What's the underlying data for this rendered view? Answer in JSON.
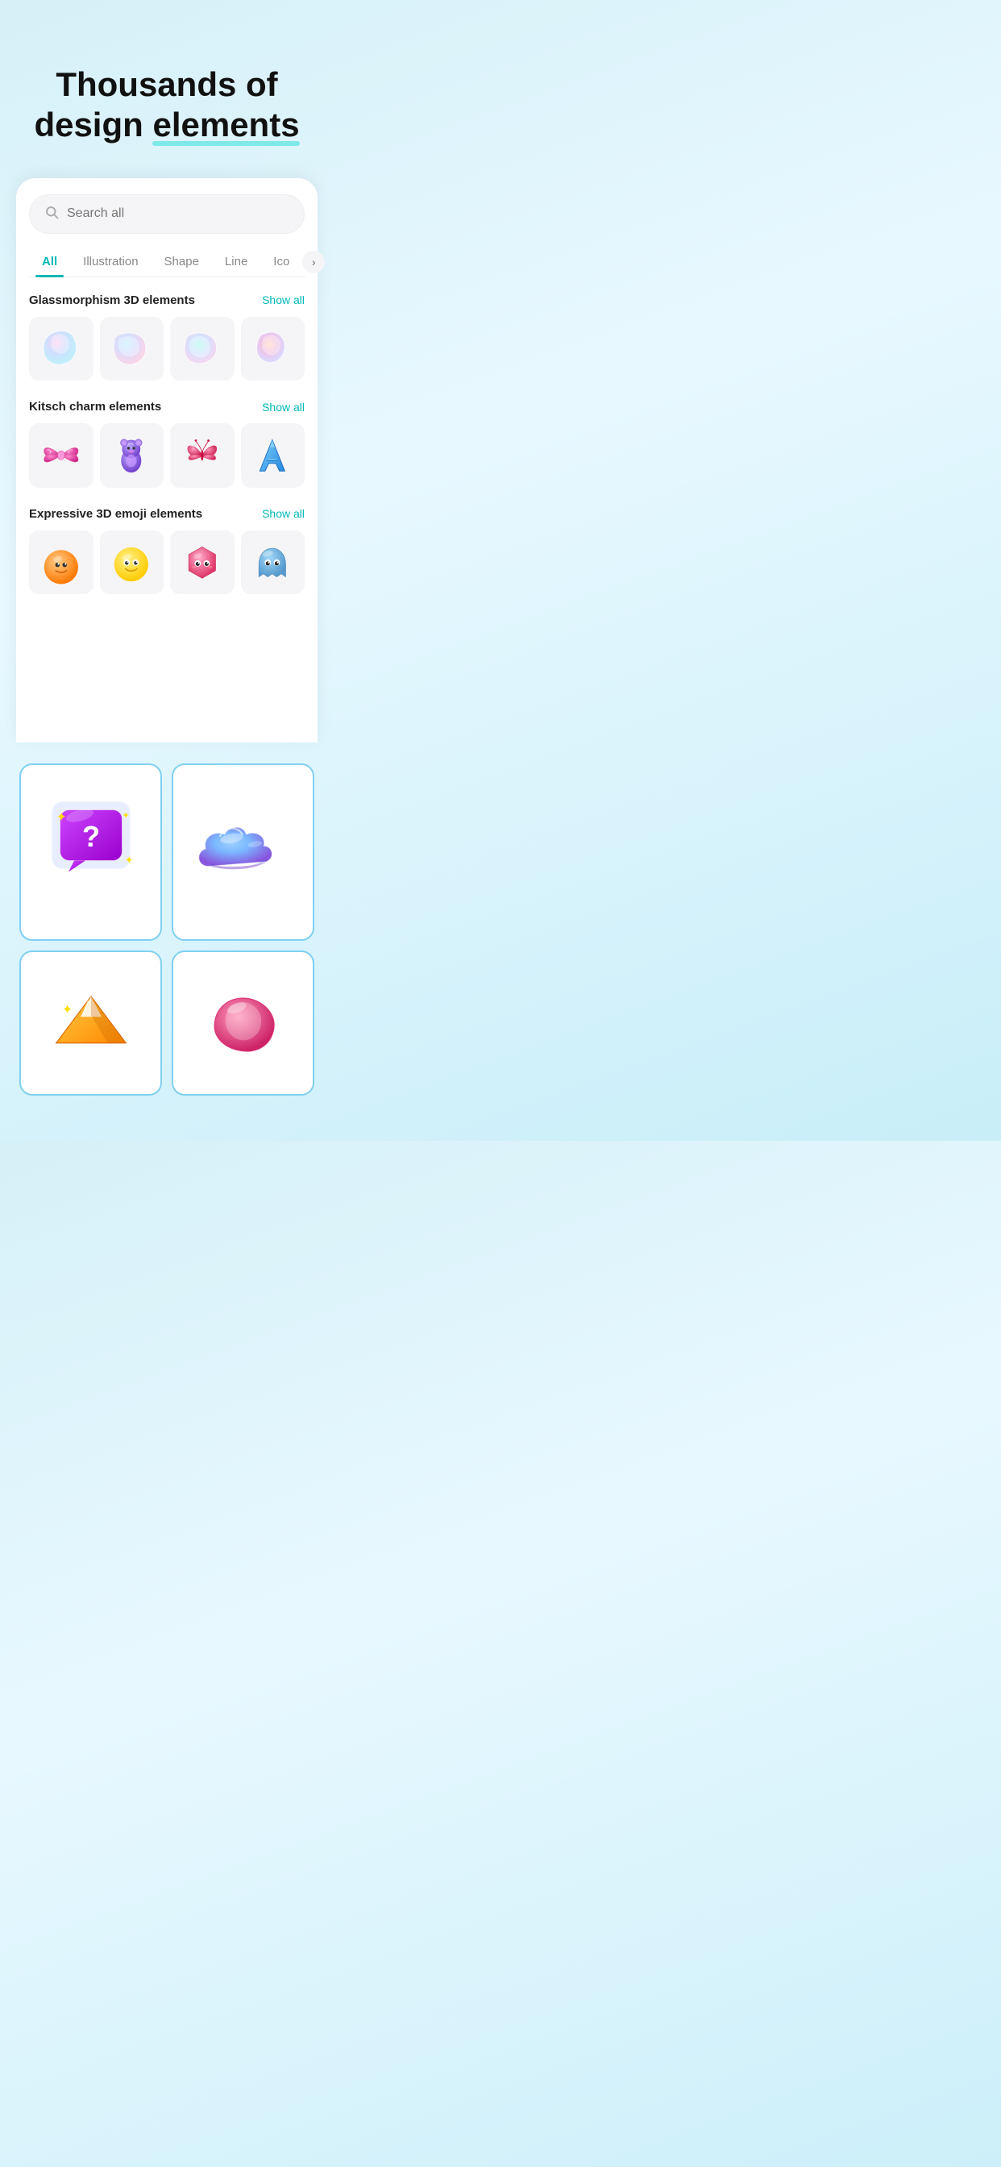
{
  "hero": {
    "line1": "Thousands of",
    "line2": "design elements",
    "highlighted_word": "elements"
  },
  "search": {
    "placeholder": "Search all"
  },
  "tabs": [
    {
      "id": "all",
      "label": "All",
      "active": true
    },
    {
      "id": "illustration",
      "label": "Illustration",
      "active": false
    },
    {
      "id": "shape",
      "label": "Shape",
      "active": false
    },
    {
      "id": "line",
      "label": "Line",
      "active": false
    },
    {
      "id": "icon",
      "label": "Icon",
      "active": false
    }
  ],
  "sections": [
    {
      "id": "glassmorphism",
      "title": "Glassmorphism 3D elements",
      "show_all_label": "Show all",
      "items": [
        {
          "id": "glass1",
          "type": "glass_blob",
          "color": "pink_blue"
        },
        {
          "id": "glass2",
          "type": "glass_blob",
          "color": "blue_green"
        },
        {
          "id": "glass3",
          "type": "glass_blob",
          "color": "teal_pink"
        },
        {
          "id": "glass4",
          "type": "glass_blob",
          "color": "pink_orange"
        }
      ]
    },
    {
      "id": "kitsch",
      "title": "Kitsch charm elements",
      "show_all_label": "Show all",
      "items": [
        {
          "id": "kitsch1",
          "type": "bow",
          "color": "pink"
        },
        {
          "id": "kitsch2",
          "type": "bear",
          "color": "purple"
        },
        {
          "id": "kitsch3",
          "type": "butterfly",
          "color": "pink"
        },
        {
          "id": "kitsch4",
          "type": "letter_a",
          "color": "blue"
        }
      ]
    },
    {
      "id": "emoji3d",
      "title": "Expressive 3D emoji elements",
      "show_all_label": "Show all",
      "items": [
        {
          "id": "emoji1",
          "type": "orange_emoji",
          "color": "orange"
        },
        {
          "id": "emoji2",
          "type": "yellow_emoji",
          "color": "yellow"
        },
        {
          "id": "emoji3",
          "type": "pink_hex",
          "color": "pink"
        },
        {
          "id": "emoji4",
          "type": "blue_ghost",
          "color": "blue"
        }
      ]
    }
  ],
  "featured": [
    {
      "id": "feat1",
      "type": "question_bubble",
      "description": "3D question mark chat bubble with stars"
    },
    {
      "id": "feat2",
      "type": "blue_cloud",
      "description": "Blue glossy 3D cloud"
    },
    {
      "id": "feat3",
      "type": "mountain",
      "description": "Mountain with sparkle"
    },
    {
      "id": "feat4",
      "type": "abstract",
      "description": "Abstract 3D shape"
    }
  ],
  "colors": {
    "accent": "#00b8b8",
    "highlight_underline": "#7fe8e8",
    "background_start": "#d6f0f8",
    "background_end": "#c8eef8",
    "card_border": "#a0e0f0"
  }
}
